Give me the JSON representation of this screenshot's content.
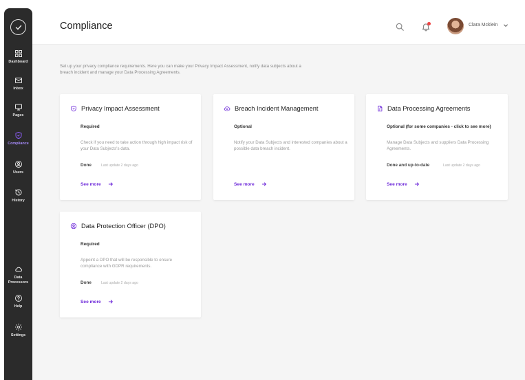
{
  "sidebar": {
    "items": [
      {
        "label": "Dashboard",
        "icon": "grid-icon"
      },
      {
        "label": "Inbox",
        "icon": "mail-icon"
      },
      {
        "label": "Pages",
        "icon": "monitor-icon"
      },
      {
        "label": "Compliance",
        "icon": "shield-icon",
        "active": true
      },
      {
        "label": "Users",
        "icon": "user-circle-icon"
      },
      {
        "label": "History",
        "icon": "history-icon"
      },
      {
        "label": "Data Processors",
        "icon": "cloud-icon"
      },
      {
        "label": "Help",
        "icon": "help-icon"
      },
      {
        "label": "Settings",
        "icon": "gear-icon"
      }
    ]
  },
  "header": {
    "title": "Compliance",
    "user_name": "Clara Mcklein"
  },
  "intro": "Set up your privacy compliance requirements. Here you can make your Privacy Impact Assessment, notify data subjects about a breach incident and manage your Data Processing Agreements.",
  "cards": [
    {
      "title": "Privacy Impact Assessment",
      "status": "Required",
      "description": "Check if you need to take action through high impact risk of your Data Subjects's data.",
      "done": "Done",
      "update": "Last update 2 days ago",
      "link": "See more"
    },
    {
      "title": "Breach Incident Management",
      "status": "Optional",
      "description": "Notify your Data Subjects and interested companies about a possible data breach incident.",
      "link": "See more"
    },
    {
      "title": "Data Processing Agreements",
      "status": "Optional (for some companies - click to see more)",
      "description": "Manage Data Subjects and suppliers Data Processing Agreements.",
      "done": "Done and up-to-date",
      "update": "Last update 2 days ago",
      "link": "See more"
    },
    {
      "title": "Data Protection Officer (DPO)",
      "status": "Required",
      "description": "Appoint a DPO that will be responsible to ensure compliance with GDPR requirements.",
      "done": "Done",
      "update": "Last update 2 days ago",
      "link": "See more"
    }
  ],
  "colors": {
    "accent": "#6d28d9",
    "sidebar_bg": "#2b2b2b",
    "notification": "#ef4444"
  }
}
